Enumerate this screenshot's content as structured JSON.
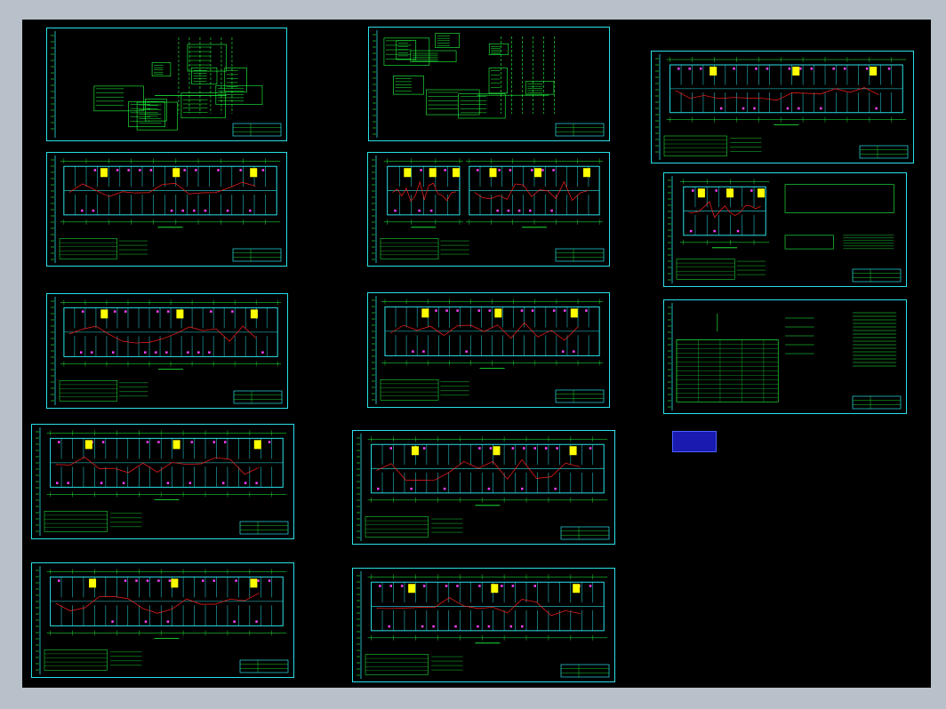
{
  "viewer": {
    "sheet_count": 13,
    "colors": {
      "background": "#000000",
      "frame": "#2ae0e8",
      "wall": "#2ae0e8",
      "circuit": "#ff2020",
      "text": "#20ff40",
      "fixture": "#ffff00",
      "symbol": "#ff40ff",
      "outer": "#b8c1ca"
    }
  },
  "stamp": {
    "line1": "",
    "line2": "",
    "line3": ""
  },
  "sheets": [
    {
      "id": "s1",
      "kind": "system"
    },
    {
      "id": "s2",
      "kind": "system"
    },
    {
      "id": "s3",
      "kind": "plan"
    },
    {
      "id": "s4",
      "kind": "plan"
    },
    {
      "id": "s5",
      "kind": "plan-split"
    },
    {
      "id": "s6",
      "kind": "detail"
    },
    {
      "id": "s7",
      "kind": "plan"
    },
    {
      "id": "s8",
      "kind": "plan"
    },
    {
      "id": "s9",
      "kind": "legend"
    },
    {
      "id": "s10",
      "kind": "plan"
    },
    {
      "id": "s11",
      "kind": "plan"
    },
    {
      "id": "s12",
      "kind": "plan"
    },
    {
      "id": "s13",
      "kind": "plan"
    }
  ]
}
